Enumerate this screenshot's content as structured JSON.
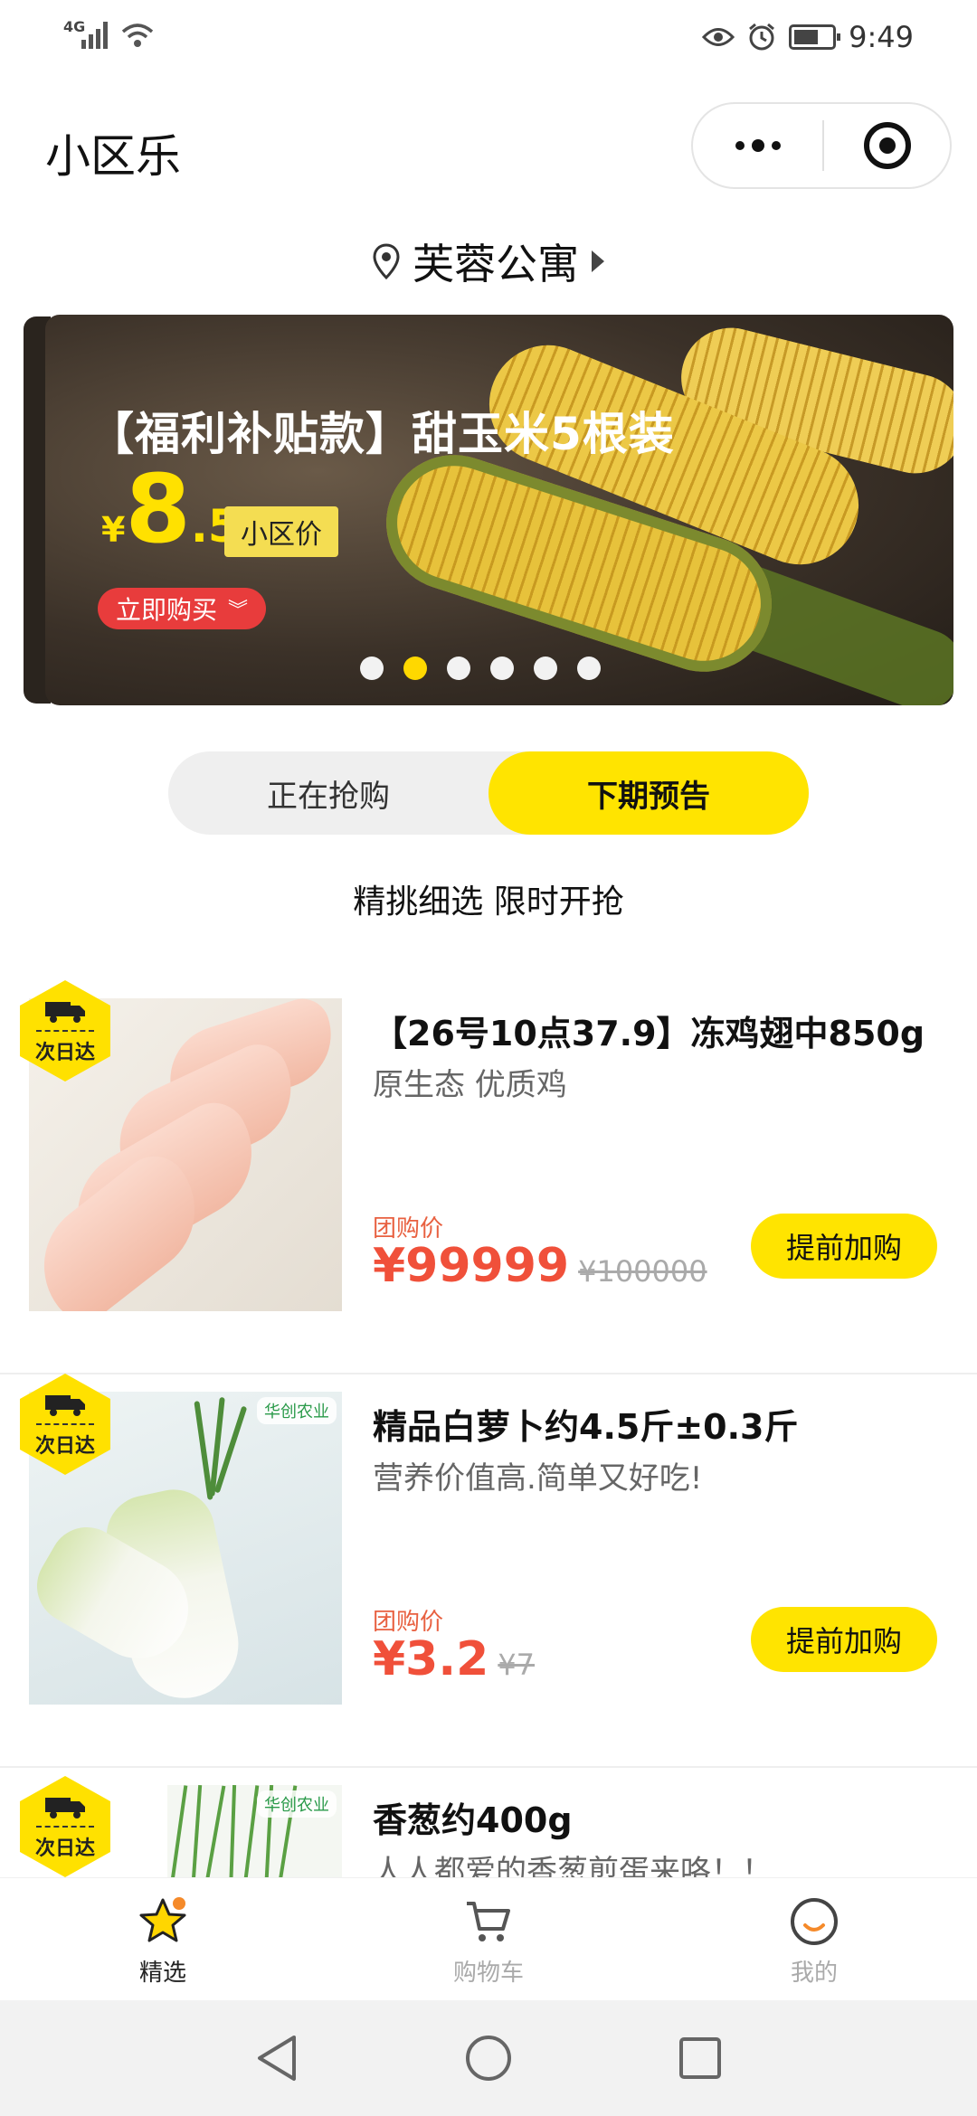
{
  "status_bar": {
    "network": "4G",
    "time": "9:49"
  },
  "header": {
    "app_title": "小区乐"
  },
  "location": {
    "name": "芙蓉公寓"
  },
  "banner": {
    "title": "【福利补贴款】甜玉米5根装",
    "currency": "¥",
    "price_int": "8",
    "price_dec": ".5",
    "tag": "小区价",
    "cta": "立即购买",
    "dots_total": 6,
    "active_dot": 2
  },
  "tabs": [
    {
      "label": "正在抢购",
      "active": false
    },
    {
      "label": "下期预告",
      "active": true
    }
  ],
  "subtitle": "精挑细选 限时开抢",
  "badge_text": "次日达",
  "products": [
    {
      "title": "【26号10点37.9】冻鸡翅中850g",
      "desc": "原生态 优质鸡",
      "label": "团购价",
      "price": "¥99999",
      "old_price": "¥100000",
      "button": "提前加购"
    },
    {
      "title": "精品白萝卜约4.5斤±0.3斤",
      "desc": "营养价值高.简单又好吃!",
      "label": "团购价",
      "price": "¥3.2",
      "old_price": "¥7",
      "button": "提前加购",
      "brand": "华创农业"
    },
    {
      "title": "香葱约400g",
      "desc": "人人都爱的香葱煎蛋来咯！！",
      "brand": "华创农业"
    }
  ],
  "bottom_nav": [
    {
      "label": "精选",
      "icon": "star-icon",
      "active": true
    },
    {
      "label": "购物车",
      "icon": "cart-icon",
      "active": false
    },
    {
      "label": "我的",
      "icon": "smile-icon",
      "active": false
    }
  ],
  "colors": {
    "accent_yellow": "#FFE400",
    "price_red": "#F0503A",
    "buy_red": "#E83C3C"
  }
}
